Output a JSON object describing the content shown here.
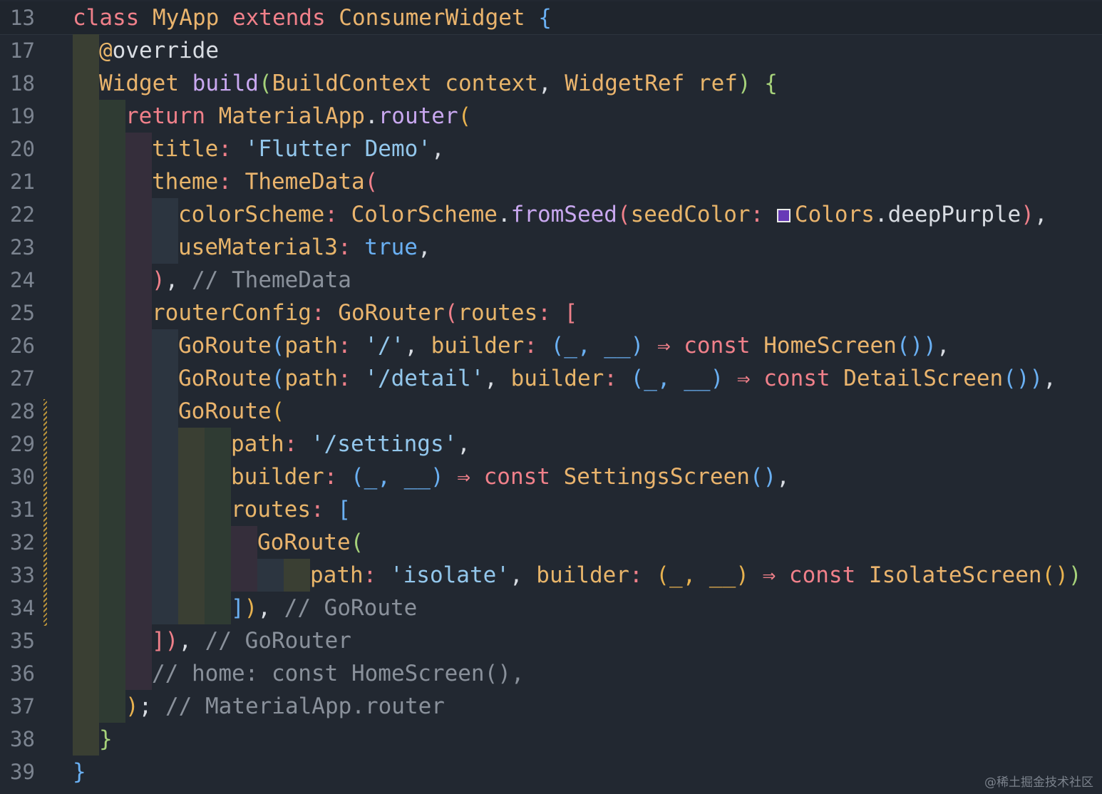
{
  "colors": {
    "background": "#222831",
    "line_number": "#7c8490",
    "keyword": "#f0808a",
    "type": "#eab46d",
    "property": "#e8b56a",
    "method": "#c9a8f0",
    "string": "#93c7ec",
    "punctuation": "#d9dde3",
    "comment": "#8a919b",
    "bracket_blue": "#6ab0f3",
    "bracket_green": "#a6d27a",
    "bracket_gold": "#e8b24f",
    "bracket_pink": "#f0808a",
    "color_swatch": "#673ab7",
    "guide_olive": "#3a3f33",
    "guide_green": "#2f3b33",
    "guide_purple": "#352e3b",
    "guide_slate": "#2c3540"
  },
  "lines": [
    {
      "no": "13",
      "guides": [],
      "indent": 0,
      "sticky": true,
      "tokens": [
        {
          "t": "class ",
          "c": "keyword"
        },
        {
          "t": "MyApp ",
          "c": "type"
        },
        {
          "t": "extends ",
          "c": "keyword"
        },
        {
          "t": "ConsumerWidget ",
          "c": "type"
        },
        {
          "t": "{",
          "c": "bracket_blue"
        }
      ]
    },
    {
      "no": "17",
      "guides": [
        "guide_olive"
      ],
      "indent": 1,
      "tokens": [
        {
          "t": "@",
          "c": "property"
        },
        {
          "t": "override",
          "c": "punctuation"
        }
      ]
    },
    {
      "no": "18",
      "guides": [
        "guide_olive"
      ],
      "indent": 1,
      "tokens": [
        {
          "t": "Widget ",
          "c": "type"
        },
        {
          "t": "build",
          "c": "method"
        },
        {
          "t": "(",
          "c": "bracket_green"
        },
        {
          "t": "BuildContext ",
          "c": "type"
        },
        {
          "t": "context",
          "c": "property"
        },
        {
          "t": ", ",
          "c": "punctuation"
        },
        {
          "t": "WidgetRef ",
          "c": "type"
        },
        {
          "t": "ref",
          "c": "property"
        },
        {
          "t": ") ",
          "c": "bracket_green"
        },
        {
          "t": "{",
          "c": "bracket_green"
        }
      ]
    },
    {
      "no": "19",
      "guides": [
        "guide_olive",
        "guide_green"
      ],
      "indent": 2,
      "tokens": [
        {
          "t": "return ",
          "c": "keyword"
        },
        {
          "t": "MaterialApp",
          "c": "type"
        },
        {
          "t": ".",
          "c": "punctuation"
        },
        {
          "t": "router",
          "c": "method"
        },
        {
          "t": "(",
          "c": "bracket_gold"
        }
      ]
    },
    {
      "no": "20",
      "guides": [
        "guide_olive",
        "guide_green",
        "guide_purple"
      ],
      "indent": 3,
      "tokens": [
        {
          "t": "title",
          "c": "property"
        },
        {
          "t": ": ",
          "c": "keyword"
        },
        {
          "t": "'Flutter Demo'",
          "c": "string"
        },
        {
          "t": ",",
          "c": "punctuation"
        }
      ]
    },
    {
      "no": "21",
      "guides": [
        "guide_olive",
        "guide_green",
        "guide_purple"
      ],
      "indent": 3,
      "tokens": [
        {
          "t": "theme",
          "c": "property"
        },
        {
          "t": ": ",
          "c": "keyword"
        },
        {
          "t": "ThemeData",
          "c": "type"
        },
        {
          "t": "(",
          "c": "bracket_pink"
        }
      ]
    },
    {
      "no": "22",
      "guides": [
        "guide_olive",
        "guide_green",
        "guide_purple",
        "guide_slate"
      ],
      "indent": 4,
      "swatch_before": "Colors",
      "tokens": [
        {
          "t": "colorScheme",
          "c": "property"
        },
        {
          "t": ": ",
          "c": "keyword"
        },
        {
          "t": "ColorScheme",
          "c": "type"
        },
        {
          "t": ".",
          "c": "punctuation"
        },
        {
          "t": "fromSeed",
          "c": "method"
        },
        {
          "t": "(",
          "c": "bracket_pink"
        },
        {
          "t": "seedColor",
          "c": "property"
        },
        {
          "t": ": ",
          "c": "keyword"
        },
        {
          "t": "Colors",
          "c": "type"
        },
        {
          "t": ".",
          "c": "punctuation"
        },
        {
          "t": "deepPurple",
          "c": "punctuation"
        },
        {
          "t": ")",
          "c": "bracket_pink"
        },
        {
          "t": ",",
          "c": "punctuation"
        }
      ]
    },
    {
      "no": "23",
      "guides": [
        "guide_olive",
        "guide_green",
        "guide_purple",
        "guide_slate"
      ],
      "indent": 4,
      "tokens": [
        {
          "t": "useMaterial3",
          "c": "property"
        },
        {
          "t": ": ",
          "c": "keyword"
        },
        {
          "t": "true",
          "c": "bracket_blue"
        },
        {
          "t": ",",
          "c": "punctuation"
        }
      ]
    },
    {
      "no": "24",
      "guides": [
        "guide_olive",
        "guide_green",
        "guide_purple"
      ],
      "indent": 3,
      "tokens": [
        {
          "t": ")",
          "c": "bracket_pink"
        },
        {
          "t": ", ",
          "c": "punctuation"
        },
        {
          "t": "// ThemeData",
          "c": "comment"
        }
      ]
    },
    {
      "no": "25",
      "guides": [
        "guide_olive",
        "guide_green",
        "guide_purple"
      ],
      "indent": 3,
      "tokens": [
        {
          "t": "routerConfig",
          "c": "property"
        },
        {
          "t": ": ",
          "c": "keyword"
        },
        {
          "t": "GoRouter",
          "c": "type"
        },
        {
          "t": "(",
          "c": "bracket_pink"
        },
        {
          "t": "routes",
          "c": "property"
        },
        {
          "t": ": ",
          "c": "keyword"
        },
        {
          "t": "[",
          "c": "bracket_pink"
        }
      ]
    },
    {
      "no": "26",
      "guides": [
        "guide_olive",
        "guide_green",
        "guide_purple",
        "guide_slate"
      ],
      "indent": 4,
      "tokens": [
        {
          "t": "GoRoute",
          "c": "type"
        },
        {
          "t": "(",
          "c": "bracket_blue"
        },
        {
          "t": "path",
          "c": "property"
        },
        {
          "t": ": ",
          "c": "keyword"
        },
        {
          "t": "'/'",
          "c": "string"
        },
        {
          "t": ", ",
          "c": "punctuation"
        },
        {
          "t": "builder",
          "c": "property"
        },
        {
          "t": ": ",
          "c": "keyword"
        },
        {
          "t": "(_, __) ",
          "c": "bracket_blue"
        },
        {
          "t": "⇒ ",
          "c": "keyword"
        },
        {
          "t": "const ",
          "c": "keyword"
        },
        {
          "t": "HomeScreen",
          "c": "type"
        },
        {
          "t": "()",
          "c": "bracket_blue"
        },
        {
          "t": ")",
          "c": "bracket_blue"
        },
        {
          "t": ",",
          "c": "punctuation"
        }
      ]
    },
    {
      "no": "27",
      "guides": [
        "guide_olive",
        "guide_green",
        "guide_purple",
        "guide_slate"
      ],
      "indent": 4,
      "tokens": [
        {
          "t": "GoRoute",
          "c": "type"
        },
        {
          "t": "(",
          "c": "bracket_blue"
        },
        {
          "t": "path",
          "c": "property"
        },
        {
          "t": ": ",
          "c": "keyword"
        },
        {
          "t": "'/detail'",
          "c": "string"
        },
        {
          "t": ", ",
          "c": "punctuation"
        },
        {
          "t": "builder",
          "c": "property"
        },
        {
          "t": ": ",
          "c": "keyword"
        },
        {
          "t": "(_, __) ",
          "c": "bracket_blue"
        },
        {
          "t": "⇒ ",
          "c": "keyword"
        },
        {
          "t": "const ",
          "c": "keyword"
        },
        {
          "t": "DetailScreen",
          "c": "type"
        },
        {
          "t": "()",
          "c": "bracket_blue"
        },
        {
          "t": ")",
          "c": "bracket_blue"
        },
        {
          "t": ",",
          "c": "punctuation"
        }
      ]
    },
    {
      "no": "28",
      "guides": [
        "guide_olive",
        "guide_green",
        "guide_purple",
        "guide_slate"
      ],
      "indent": 4,
      "tokens": [
        {
          "t": "GoRoute",
          "c": "type"
        },
        {
          "t": "(",
          "c": "bracket_gold"
        }
      ]
    },
    {
      "no": "29",
      "guides": [
        "guide_olive",
        "guide_green",
        "guide_purple",
        "guide_slate",
        "guide_olive",
        "guide_green"
      ],
      "indent": 6,
      "tokens": [
        {
          "t": "path",
          "c": "property"
        },
        {
          "t": ": ",
          "c": "keyword"
        },
        {
          "t": "'/settings'",
          "c": "string"
        },
        {
          "t": ",",
          "c": "punctuation"
        }
      ]
    },
    {
      "no": "30",
      "guides": [
        "guide_olive",
        "guide_green",
        "guide_purple",
        "guide_slate",
        "guide_olive",
        "guide_green"
      ],
      "indent": 6,
      "tokens": [
        {
          "t": "builder",
          "c": "property"
        },
        {
          "t": ": ",
          "c": "keyword"
        },
        {
          "t": "(_, __) ",
          "c": "bracket_blue"
        },
        {
          "t": "⇒ ",
          "c": "keyword"
        },
        {
          "t": "const ",
          "c": "keyword"
        },
        {
          "t": "SettingsScreen",
          "c": "type"
        },
        {
          "t": "()",
          "c": "bracket_blue"
        },
        {
          "t": ",",
          "c": "punctuation"
        }
      ]
    },
    {
      "no": "31",
      "guides": [
        "guide_olive",
        "guide_green",
        "guide_purple",
        "guide_slate",
        "guide_olive",
        "guide_green"
      ],
      "indent": 6,
      "tokens": [
        {
          "t": "routes",
          "c": "property"
        },
        {
          "t": ": ",
          "c": "keyword"
        },
        {
          "t": "[",
          "c": "bracket_blue"
        }
      ]
    },
    {
      "no": "32",
      "guides": [
        "guide_olive",
        "guide_green",
        "guide_purple",
        "guide_slate",
        "guide_olive",
        "guide_green",
        "guide_purple"
      ],
      "indent": 7,
      "tokens": [
        {
          "t": "GoRoute",
          "c": "type"
        },
        {
          "t": "(",
          "c": "bracket_green"
        }
      ]
    },
    {
      "no": "33",
      "guides": [
        "guide_olive",
        "guide_green",
        "guide_purple",
        "guide_slate",
        "guide_olive",
        "guide_green",
        "guide_purple",
        "guide_slate",
        "guide_olive"
      ],
      "indent": 9,
      "tokens": [
        {
          "t": "path",
          "c": "property"
        },
        {
          "t": ": ",
          "c": "keyword"
        },
        {
          "t": "'isolate'",
          "c": "string"
        },
        {
          "t": ", ",
          "c": "punctuation"
        },
        {
          "t": "builder",
          "c": "property"
        },
        {
          "t": ": ",
          "c": "keyword"
        },
        {
          "t": "(_, __) ",
          "c": "bracket_gold"
        },
        {
          "t": "⇒ ",
          "c": "keyword"
        },
        {
          "t": "const ",
          "c": "keyword"
        },
        {
          "t": "IsolateScreen",
          "c": "type"
        },
        {
          "t": "()",
          "c": "bracket_gold"
        },
        {
          "t": ")",
          "c": "bracket_green"
        }
      ]
    },
    {
      "no": "34",
      "guides": [
        "guide_olive",
        "guide_green",
        "guide_purple",
        "guide_slate",
        "guide_olive",
        "guide_green"
      ],
      "indent": 6,
      "tokens": [
        {
          "t": "]",
          "c": "bracket_blue"
        },
        {
          "t": ")",
          "c": "bracket_gold"
        },
        {
          "t": ", ",
          "c": "punctuation"
        },
        {
          "t": "// GoRoute",
          "c": "comment"
        }
      ]
    },
    {
      "no": "35",
      "guides": [
        "guide_olive",
        "guide_green",
        "guide_purple"
      ],
      "indent": 3,
      "tokens": [
        {
          "t": "]",
          "c": "bracket_pink"
        },
        {
          "t": ")",
          "c": "bracket_pink"
        },
        {
          "t": ", ",
          "c": "punctuation"
        },
        {
          "t": "// GoRouter",
          "c": "comment"
        }
      ]
    },
    {
      "no": "36",
      "guides": [
        "guide_olive",
        "guide_green",
        "guide_purple"
      ],
      "indent": 3,
      "tokens": [
        {
          "t": "// home: const HomeScreen(),",
          "c": "comment"
        }
      ]
    },
    {
      "no": "37",
      "guides": [
        "guide_olive",
        "guide_green"
      ],
      "indent": 2,
      "tokens": [
        {
          "t": ")",
          "c": "bracket_gold"
        },
        {
          "t": "; ",
          "c": "punctuation"
        },
        {
          "t": "// MaterialApp.router",
          "c": "comment"
        }
      ]
    },
    {
      "no": "38",
      "guides": [
        "guide_olive"
      ],
      "indent": 1,
      "tokens": [
        {
          "t": "}",
          "c": "bracket_green"
        }
      ]
    },
    {
      "no": "39",
      "guides": [],
      "indent": 0,
      "tokens": [
        {
          "t": "}",
          "c": "bracket_blue"
        }
      ]
    }
  ],
  "watermark": "@稀土掘金技术社区"
}
